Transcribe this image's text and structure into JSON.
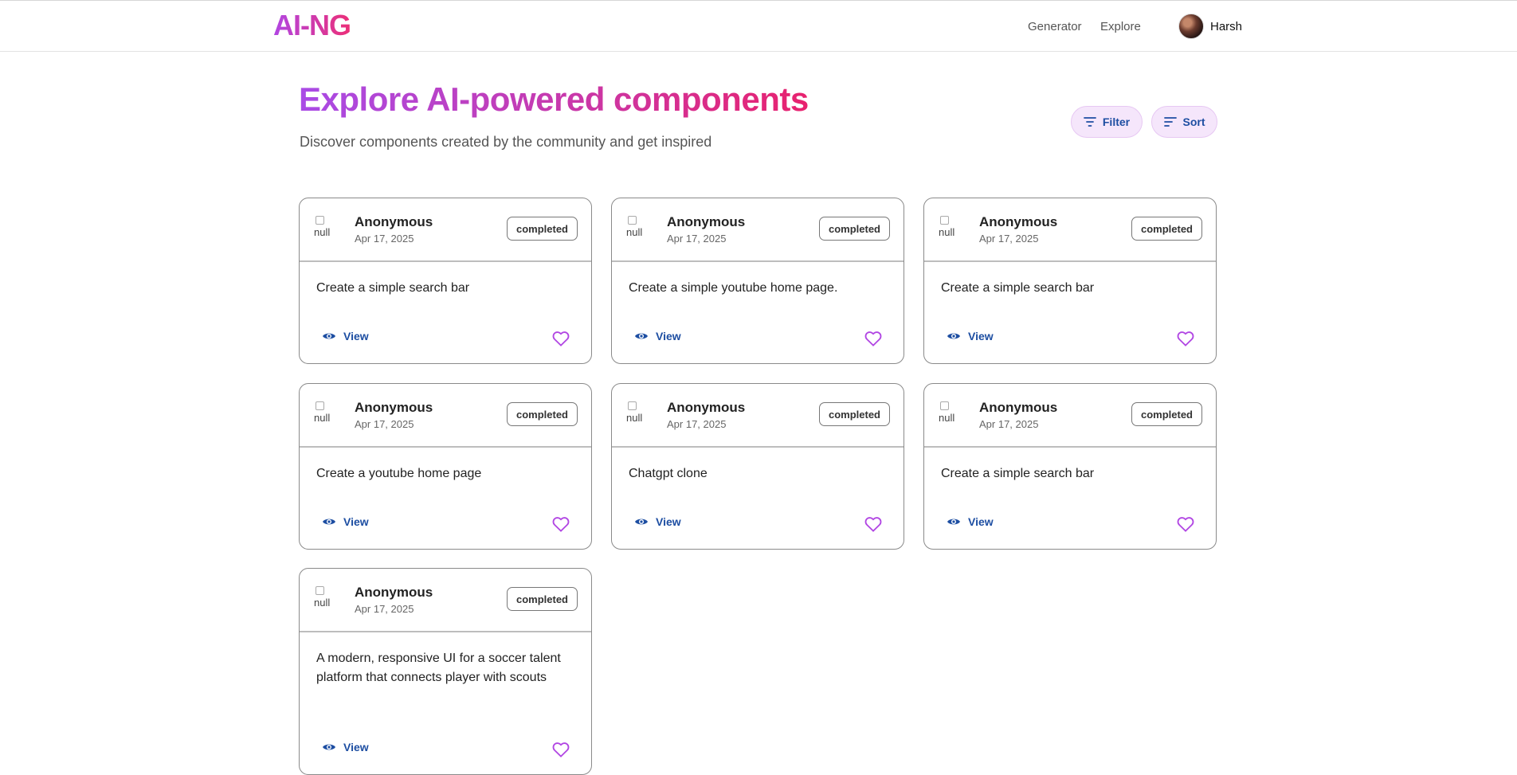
{
  "nav": {
    "logo": "AI-NG",
    "links": [
      "Generator",
      "Explore"
    ],
    "user_name": "Harsh"
  },
  "page": {
    "title": "Explore AI-powered components",
    "subtitle": "Discover components created by the community and get inspired",
    "filter_label": "Filter",
    "sort_label": "Sort"
  },
  "cards": [
    {
      "author": "Anonymous",
      "date": "Apr 17, 2025",
      "status": "completed",
      "prompt": "Create a simple search bar",
      "avatar_alt": "null",
      "view_label": "View"
    },
    {
      "author": "Anonymous",
      "date": "Apr 17, 2025",
      "status": "completed",
      "prompt": "Create a simple youtube home page.",
      "avatar_alt": "null",
      "view_label": "View"
    },
    {
      "author": "Anonymous",
      "date": "Apr 17, 2025",
      "status": "completed",
      "prompt": "Create a simple search bar",
      "avatar_alt": "null",
      "view_label": "View"
    },
    {
      "author": "Anonymous",
      "date": "Apr 17, 2025",
      "status": "completed",
      "prompt": "Create a youtube home page",
      "avatar_alt": "null",
      "view_label": "View"
    },
    {
      "author": "Anonymous",
      "date": "Apr 17, 2025",
      "status": "completed",
      "prompt": "Chatgpt clone",
      "avatar_alt": "null",
      "view_label": "View"
    },
    {
      "author": "Anonymous",
      "date": "Apr 17, 2025",
      "status": "completed",
      "prompt": "Create a simple search bar",
      "avatar_alt": "null",
      "view_label": "View"
    },
    {
      "author": "Anonymous",
      "date": "Apr 17, 2025",
      "status": "completed",
      "prompt": "A modern, responsive UI for a soccer talent platform that connects player with scouts",
      "avatar_alt": "null",
      "view_label": "View"
    }
  ],
  "icons": {
    "filter": "filter-icon",
    "sort": "sort-icon",
    "view": "eye-icon",
    "favorite": "heart-icon"
  },
  "colors": {
    "accent_gradient_start": "#a94be6",
    "accent_gradient_end": "#e8226e",
    "link_blue": "#1d4ea2",
    "heart": "#b146e3",
    "pill_bg": "#f5e6fb"
  }
}
